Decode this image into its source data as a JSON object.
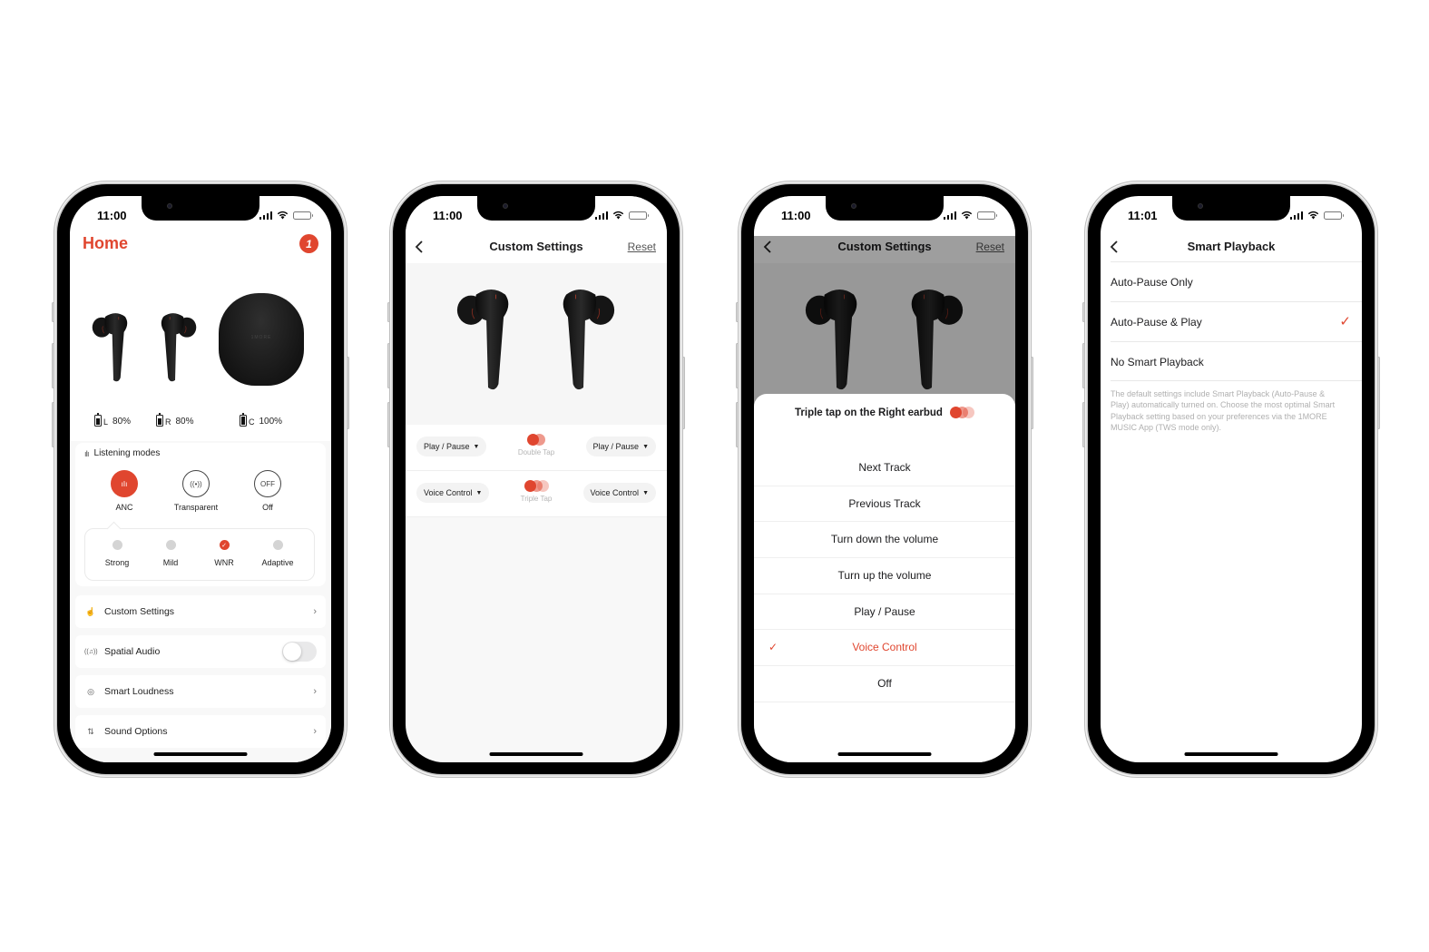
{
  "colors": {
    "accent": "#e0462f",
    "muted_text": "#b0b0b0",
    "pill_bg": "#f3f3f3"
  },
  "screens": [
    {
      "status_time": "11:00",
      "title": "Home",
      "brand_badge": "1",
      "case_logo": "1MORE",
      "battery": [
        {
          "label": "L",
          "value": "80%",
          "level": 0.8
        },
        {
          "label": "R",
          "value": "80%",
          "level": 0.8
        },
        {
          "label": "C",
          "value": "100%",
          "level": 1.0
        }
      ],
      "listening_modes": {
        "heading": "Listening modes",
        "modes": [
          {
            "label": "ANC",
            "icon": "anc-wave-icon",
            "glyph": "ıIı",
            "active": true
          },
          {
            "label": "Transparent",
            "icon": "transparent-icon",
            "glyph": "((•))",
            "active": false
          },
          {
            "label": "Off",
            "icon": "off-icon",
            "glyph": "OFF",
            "active": false
          }
        ],
        "anc_levels": [
          {
            "label": "Strong",
            "selected": false
          },
          {
            "label": "Mild",
            "selected": false
          },
          {
            "label": "WNR",
            "selected": true
          },
          {
            "label": "Adaptive",
            "selected": false
          }
        ]
      },
      "menu": [
        {
          "label": "Custom Settings",
          "icon": "touch-icon",
          "glyph": "☝",
          "control": "chevron"
        },
        {
          "label": "Spatial Audio",
          "icon": "spatial-audio-icon",
          "glyph": "((♫))",
          "control": "toggle",
          "on": false
        },
        {
          "label": "Smart Loudness",
          "icon": "loudness-icon",
          "glyph": "◎",
          "control": "chevron"
        },
        {
          "label": "Sound Options",
          "icon": "equalizer-icon",
          "glyph": "⇅",
          "control": "chevron"
        }
      ]
    },
    {
      "status_time": "11:00",
      "title": "Custom Settings",
      "reset_label": "Reset",
      "gestures": [
        {
          "left": "Play / Pause",
          "gesture": "Double Tap",
          "right": "Play / Pause",
          "taps": 2
        },
        {
          "left": "Voice Control",
          "gesture": "Triple Tap",
          "right": "Voice Control",
          "taps": 3
        }
      ]
    },
    {
      "status_time": "11:00",
      "title": "Custom Settings",
      "reset_label": "Reset",
      "sheet_title": "Triple tap on the Right earbud",
      "options": [
        {
          "label": "Next Track",
          "selected": false
        },
        {
          "label": "Previous Track",
          "selected": false
        },
        {
          "label": "Turn down the volume",
          "selected": false
        },
        {
          "label": "Turn up the volume",
          "selected": false
        },
        {
          "label": "Play / Pause",
          "selected": false
        },
        {
          "label": "Voice Control",
          "selected": true
        },
        {
          "label": "Off",
          "selected": false
        }
      ]
    },
    {
      "status_time": "11:01",
      "title": "Smart Playback",
      "options": [
        {
          "label": "Auto-Pause Only",
          "selected": false
        },
        {
          "label": "Auto-Pause & Play",
          "selected": true
        },
        {
          "label": "No Smart Playback",
          "selected": false
        }
      ],
      "note": "The default settings include Smart Playback (Auto-Pause & Play) automatically turned on. Choose the most optimal Smart Playback setting based on your preferences via the 1MORE MUSIC App (TWS mode only)."
    }
  ],
  "common": {
    "check_glyph": "✓",
    "chevron_glyph": "›",
    "caret_glyph": "▼"
  }
}
